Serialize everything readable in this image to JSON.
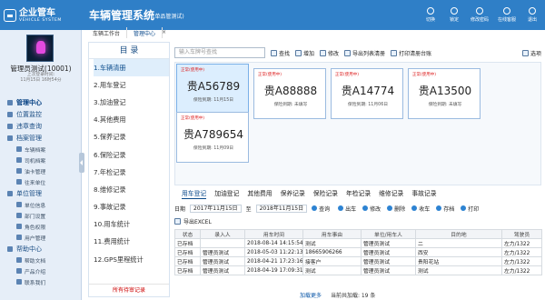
{
  "app": {
    "logo_cn": "企业管车",
    "logo_en": "VEHICLE SYSTEM",
    "title": "车辆管理系统",
    "subtitle": "(单品管测试)"
  },
  "top_actions": [
    {
      "label": "切换"
    },
    {
      "label": "锁定"
    },
    {
      "label": "修改密码"
    },
    {
      "label": "在线客服"
    },
    {
      "label": "退出"
    }
  ],
  "user": {
    "name": "管理员测试(10001)",
    "last_login": "上次登录时间:",
    "last_login_time": "11月15日 16时54分"
  },
  "sidebar": {
    "sections": [
      {
        "label": "管理中心",
        "icon": "home-icon",
        "active": true,
        "items": []
      },
      {
        "label": "位置监控",
        "icon": "location-icon",
        "items": []
      },
      {
        "label": "违章查询",
        "icon": "search-icon",
        "items": []
      },
      {
        "label": "档案管理",
        "icon": "folder-icon",
        "items": [
          "车辆档案",
          "司机档案",
          "油卡管理",
          "往来单位"
        ]
      },
      {
        "label": "单位管理",
        "icon": "unit-icon",
        "items": [
          "单位信息",
          "部门设置",
          "角色权限",
          "用户管理"
        ]
      },
      {
        "label": "帮助中心",
        "icon": "help-icon",
        "items": [
          "帮助文档",
          "产品介绍",
          "联系我们"
        ]
      }
    ]
  },
  "tabs": [
    {
      "label": "车辆工作台"
    },
    {
      "label": "管理中心",
      "active": true
    }
  ],
  "directory": {
    "title": "目 录",
    "items": [
      "1.车辆清册",
      "2.用车登记",
      "3.加油登记",
      "4.其他费用",
      "5.保养记录",
      "6.保险记录",
      "7.年检记录",
      "8.维修记录",
      "9.事故记录",
      "10.用车统计",
      "11.费用统计",
      "12.GPS里程统计"
    ],
    "footer": "所有待审记录"
  },
  "toolbar": {
    "search_placeholder": "输入车牌号查找",
    "buttons": [
      "查找",
      "增加",
      "修改",
      "导出列表清册",
      "打印清册台账",
      "选项"
    ]
  },
  "cards": [
    {
      "status": "正常(使用中)",
      "plate": "贵A56789",
      "date": "保险到期: 11月15日",
      "selected": true
    },
    {
      "status": "正常(使用中)",
      "plate": "贵A88888",
      "date": "保险到期: 未填写"
    },
    {
      "status": "正常(使用中)",
      "plate": "贵A14774",
      "date": "保险到期: 11月06日"
    },
    {
      "status": "正常(使用中)",
      "plate": "贵A13500",
      "date": "保险到期: 未填写"
    },
    {
      "status": "正常(使用中)",
      "plate": "贵A789654",
      "date": "保险到期: 11月09日"
    }
  ],
  "bottom_tabs": [
    "用车登记",
    "加油登记",
    "其他费用",
    "保养记录",
    "保险记录",
    "年检记录",
    "维修记录",
    "事故记录"
  ],
  "filter": {
    "date_label": "日期",
    "from": "2017年11月15日",
    "to_label": "至",
    "to": "2018年11月15日",
    "query": "查询",
    "actions": [
      "出车",
      "修改",
      "删除",
      "收车",
      "存档",
      "打印"
    ]
  },
  "export_label": "导出EXCEL",
  "table": {
    "headers": [
      "状态",
      "录入人",
      "用车时间",
      "用车事由",
      "单位/用车人",
      "目的地",
      "驾驶员"
    ],
    "rows": [
      [
        "已存档",
        "",
        "2018-08-14 14:15:54",
        "测试",
        "管理员测试",
        "二",
        "左力/1322"
      ],
      [
        "已存档",
        "管理员测试",
        "2018-05-03 11:22:13",
        "18665906266",
        "管理员测试",
        "西安",
        "左力/1322"
      ],
      [
        "已存档",
        "管理员测试",
        "2018-04-21 17:23:16",
        "接客户",
        "管理员测试",
        "贵阳花站",
        "左力/1322"
      ],
      [
        "已存档",
        "管理员测试",
        "2018-04-19 17:09:31",
        "测试",
        "管理员测试",
        "测试",
        "左力/1322"
      ]
    ]
  },
  "footer": {
    "load_more": "加载更多",
    "count": "当前共加载: 19 条"
  }
}
